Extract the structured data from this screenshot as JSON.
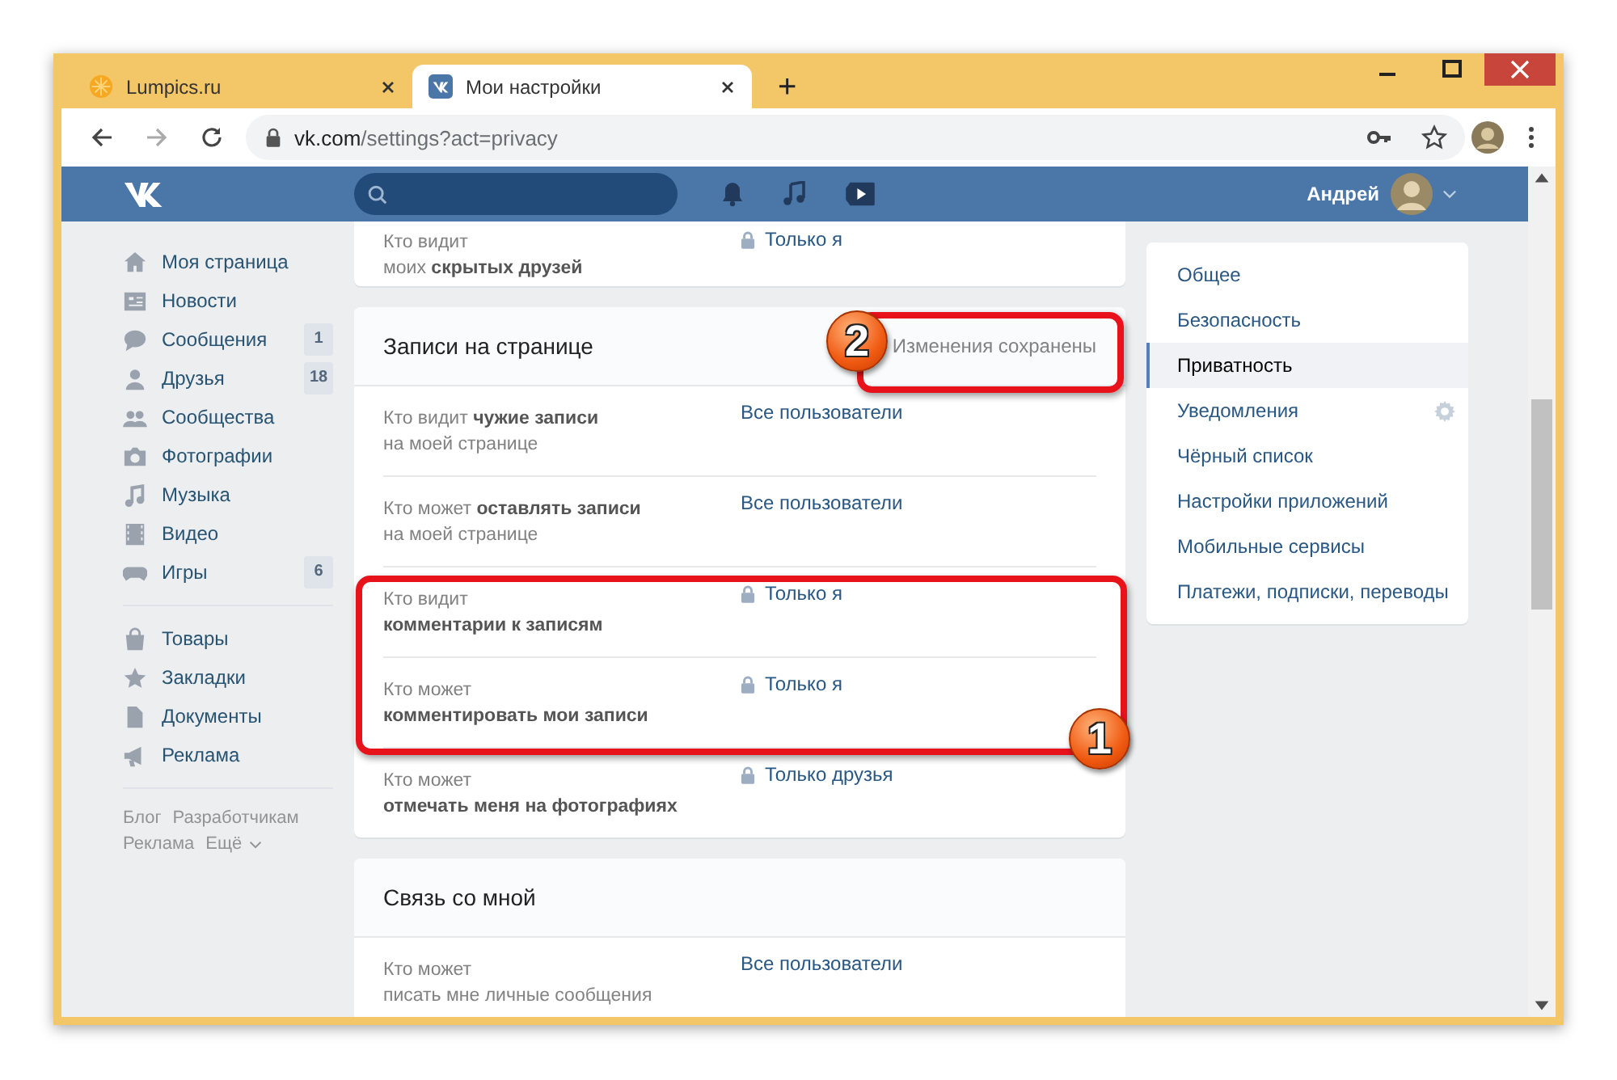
{
  "browser": {
    "tabs": [
      {
        "title": "Lumpics.ru",
        "selected": false
      },
      {
        "title": "Мои настройки",
        "selected": true
      }
    ],
    "new_tab": "+",
    "url": {
      "host": "vk.com",
      "path": "/settings?act=privacy"
    }
  },
  "header": {
    "user_name": "Андрей"
  },
  "left_nav": {
    "groups": [
      [
        {
          "label": "Моя страница"
        },
        {
          "label": "Новости"
        },
        {
          "label": "Сообщения",
          "count": "1"
        },
        {
          "label": "Друзья",
          "count": "18"
        },
        {
          "label": "Сообщества"
        },
        {
          "label": "Фотографии"
        },
        {
          "label": "Музыка"
        },
        {
          "label": "Видео"
        },
        {
          "label": "Игры",
          "count": "6"
        }
      ],
      [
        {
          "label": "Товары"
        },
        {
          "label": "Закладки"
        },
        {
          "label": "Документы"
        },
        {
          "label": "Реклама"
        }
      ]
    ],
    "footer_links": [
      "Блог",
      "Разработчикам",
      "Реклама",
      "Ещё"
    ]
  },
  "sections": [
    {
      "rows": [
        {
          "label": "Кто видит\nмоих **скрытых друзей**",
          "value": "Только я",
          "locked": true
        }
      ]
    },
    {
      "title": "Записи на странице",
      "notice": "Изменения сохранены",
      "rows": [
        {
          "label": "Кто видит **чужие записи**\nна моей странице",
          "value": "Все пользователи",
          "locked": false
        },
        {
          "label": "Кто может **оставлять записи**\nна моей странице",
          "value": "Все пользователи",
          "locked": false
        },
        {
          "label": "Кто видит\n**комментарии к записям**",
          "value": "Только я",
          "locked": true
        },
        {
          "label": "Кто может\n**комментировать мои записи**",
          "value": "Только я",
          "locked": true
        },
        {
          "label": "Кто может\n**отмечать меня на фотографиях**",
          "value": "Только друзья",
          "locked": true
        }
      ]
    },
    {
      "title": "Связь со мной",
      "rows": [
        {
          "label": "Кто может\nписать мне личные сообщения",
          "value": "Все пользователи",
          "locked": false
        }
      ]
    }
  ],
  "settings_menu": {
    "items": [
      {
        "label": "Общее",
        "selected": false,
        "gear": false
      },
      {
        "label": "Безопасность",
        "selected": false,
        "gear": false
      },
      {
        "label": "Приватность",
        "selected": true,
        "gear": false
      },
      {
        "label": "Уведомления",
        "selected": false,
        "gear": true
      },
      {
        "label": "Чёрный список",
        "selected": false,
        "gear": false
      },
      {
        "label": "Настройки приложений",
        "selected": false,
        "gear": false
      },
      {
        "label": "Мобильные сервисы",
        "selected": false,
        "gear": false
      },
      {
        "label": "Платежи, подписки, переводы",
        "selected": false,
        "gear": false
      }
    ]
  },
  "annotations": [
    {
      "number": "2"
    },
    {
      "number": "1"
    }
  ]
}
